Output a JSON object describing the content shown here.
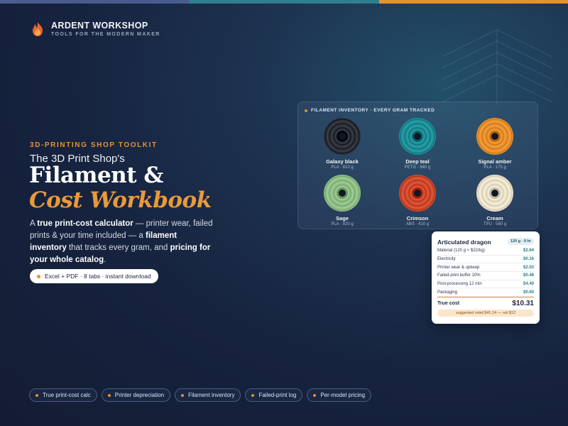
{
  "brand": {
    "name": "ARDENT WORKSHOP",
    "tagline": "TOOLS FOR THE MODERN MAKER"
  },
  "hero": {
    "eyebrow": "3D-PRINTING SHOP TOOLKIT",
    "subtitle": "The 3D Print Shop's",
    "title_line1": "Filament &",
    "title_line2": "Cost Workbook",
    "description": [
      {
        "text": "A ",
        "bold": false
      },
      {
        "text": "true print-cost calculator",
        "bold": true
      },
      {
        "text": " — printer wear, failed prints & your time included — a ",
        "bold": false
      },
      {
        "text": "filament inventory",
        "bold": true
      },
      {
        "text": " that tracks every gram, and ",
        "bold": false
      },
      {
        "text": "pricing for your whole catalog",
        "bold": true
      },
      {
        "text": ".",
        "bold": false
      }
    ],
    "download_pill": "Excel + PDF · 8 tabs · instant download"
  },
  "inventory": {
    "heading": "FILAMENT INVENTORY · EVERY GRAM TRACKED",
    "spools": [
      {
        "name": "Galaxy black",
        "meta": "PLA · 810 g",
        "color": "#2b2f38"
      },
      {
        "name": "Deep teal",
        "meta": "PETG · 840 g",
        "color": "#1f8f98"
      },
      {
        "name": "Signal amber",
        "meta": "PLA · 175 g",
        "color": "#e8902e"
      },
      {
        "name": "Sage",
        "meta": "PLA · 920 g",
        "color": "#8fbf87"
      },
      {
        "name": "Crimson",
        "meta": "ABS · 410 g",
        "color": "#cf4a2e"
      },
      {
        "name": "Cream",
        "meta": "TPU · 580 g",
        "color": "#ece2cb"
      }
    ]
  },
  "cost_card": {
    "title": "Articulated dragon",
    "chip": "120 g · 9 hr",
    "rows": [
      {
        "label": "Material (120 g × $22/kg)",
        "value": "$2.64"
      },
      {
        "label": "Electricity",
        "value": "$0.16"
      },
      {
        "label": "Printer wear & upkeep",
        "value": "$2.03"
      },
      {
        "label": "Failed-print buffer 10%",
        "value": "$0.48"
      },
      {
        "label": "Post-processing 12 min",
        "value": "$4.40"
      },
      {
        "label": "Packaging",
        "value": "$0.60"
      }
    ],
    "total_label": "True cost",
    "total_value": "$10.31",
    "note": "suggested retail $41.24 — not $12"
  },
  "features": [
    "True print-cost calc",
    "Printer depreciation",
    "Filament inventory",
    "Failed-print log",
    "Per-model pricing"
  ],
  "colors": {
    "accent": "#e8902e",
    "teal": "#2a7d86",
    "background": "#16233f"
  }
}
